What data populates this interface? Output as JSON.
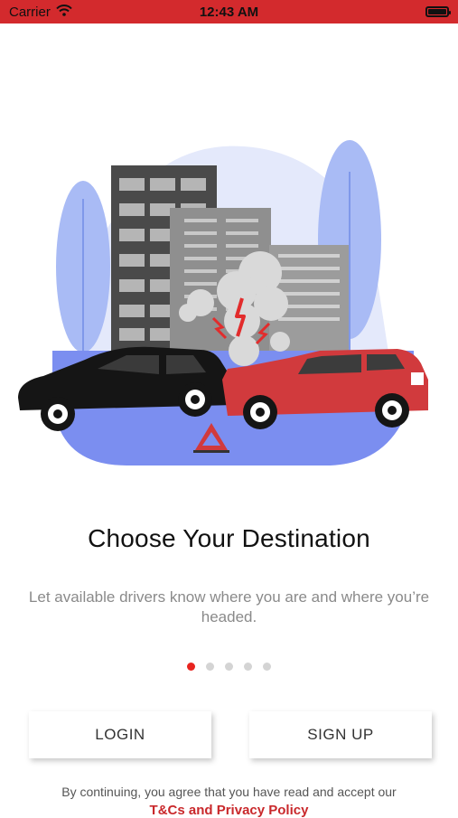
{
  "status_bar": {
    "carrier": "Carrier",
    "time": "12:43 AM",
    "background": "#d32a2d",
    "wifi_icon": "wifi-icon",
    "battery_icon": "battery-icon"
  },
  "onboarding": {
    "illustration": "car-crash-illustration",
    "title": "Choose Your Destination",
    "subtitle": "Let available drivers know where you are and where you’re headed.",
    "page_count": 5,
    "active_page": 1,
    "active_dot_color": "#e8241f"
  },
  "actions": {
    "login_label": "LOGIN",
    "signup_label": "SIGN UP"
  },
  "footer": {
    "terms_text": "By continuing, you agree that you have read and accept our",
    "terms_link": "T&Cs and Privacy Policy",
    "link_color": "#c9282b"
  }
}
